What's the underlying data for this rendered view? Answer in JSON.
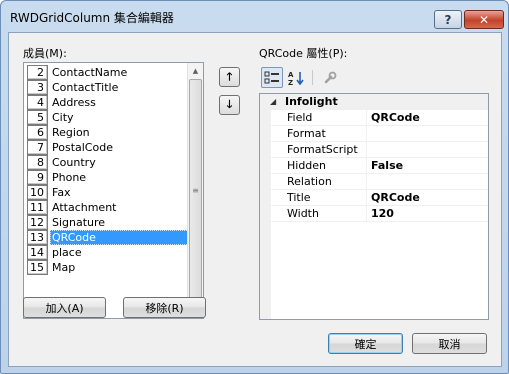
{
  "window": {
    "title": "RWDGridColumn 集合編輯器",
    "help_label": "?",
    "close_label": "✕"
  },
  "members": {
    "label": "成員(M):",
    "items": [
      {
        "index": "2",
        "name": "ContactName"
      },
      {
        "index": "3",
        "name": "ContactTitle"
      },
      {
        "index": "4",
        "name": "Address"
      },
      {
        "index": "5",
        "name": "City"
      },
      {
        "index": "6",
        "name": "Region"
      },
      {
        "index": "7",
        "name": "PostalCode"
      },
      {
        "index": "8",
        "name": "Country"
      },
      {
        "index": "9",
        "name": "Phone"
      },
      {
        "index": "10",
        "name": "Fax"
      },
      {
        "index": "11",
        "name": "Attachment"
      },
      {
        "index": "12",
        "name": "Signature"
      },
      {
        "index": "13",
        "name": "QRCode",
        "selected": true
      },
      {
        "index": "14",
        "name": "place"
      },
      {
        "index": "15",
        "name": "Map"
      }
    ],
    "add_label": "加入(A)",
    "remove_label": "移除(R)",
    "move_up_label": "🡑",
    "move_down_label": "🡓"
  },
  "properties": {
    "label": "QRCode 屬性(P):",
    "category": "Infolight",
    "category_toggle": "◢",
    "rows": [
      {
        "name": "Field",
        "value": "QRCode"
      },
      {
        "name": "Format",
        "value": ""
      },
      {
        "name": "FormatScript",
        "value": ""
      },
      {
        "name": "Hidden",
        "value": "False"
      },
      {
        "name": "Relation",
        "value": ""
      },
      {
        "name": "Title",
        "value": "QRCode"
      },
      {
        "name": "Width",
        "value": "120"
      }
    ]
  },
  "footer": {
    "ok_label": "確定",
    "cancel_label": "取消"
  },
  "colors": {
    "selection": "#3399ff",
    "title_bar": "#c9dcef"
  }
}
